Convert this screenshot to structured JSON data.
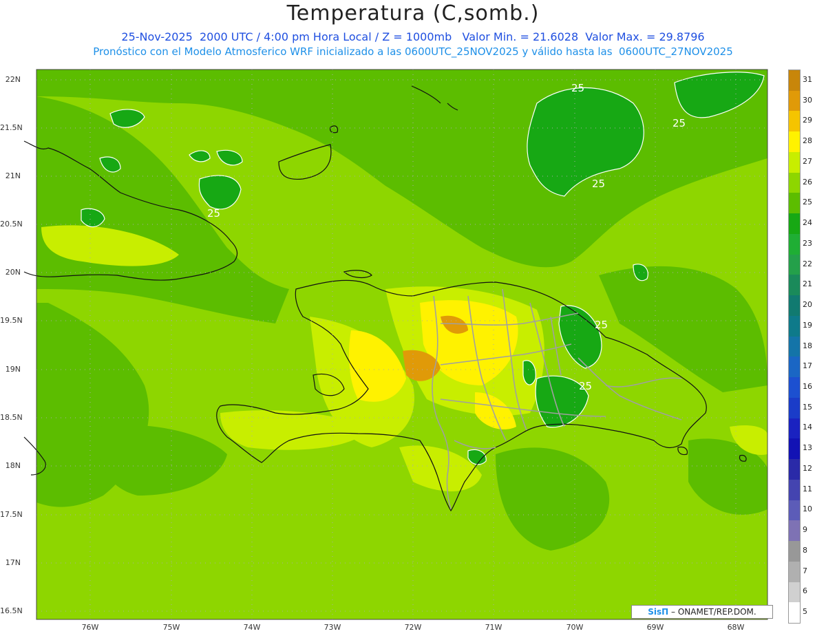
{
  "title": "Temperatura (C,somb.)",
  "subtitle_line1": "25-Nov-2025  2000 UTC / 4:00 pm Hora Local / Z = 1000mb   Valor Min. = 21.6028  Valor Max. = 29.8796",
  "subtitle_line2": "Pronóstico con el Modelo Atmosferico WRF inicializado a las 0600UTC_25NOV2025 y válido hasta las  0600UTC_27NOV2025",
  "lat_ticks": [
    "22N",
    "21.5N",
    "21N",
    "20.5N",
    "20N",
    "19.5N",
    "19N",
    "18.5N",
    "18N",
    "17.5N",
    "17N",
    "16.5N"
  ],
  "lon_ticks": [
    "76W",
    "75W",
    "74W",
    "73W",
    "72W",
    "71W",
    "70W",
    "69W",
    "68W"
  ],
  "contour_labels": [
    "25",
    "25",
    "25",
    "25",
    "25",
    "25",
    "25"
  ],
  "colorbar": {
    "levels": [
      "31",
      "30",
      "29",
      "28",
      "27",
      "26",
      "25",
      "24",
      "23",
      "22",
      "21",
      "20",
      "19",
      "18",
      "17",
      "16",
      "15",
      "14",
      "13",
      "12",
      "11",
      "10",
      "9",
      "8",
      "7",
      "6",
      "5"
    ],
    "colors": [
      "#c8860a",
      "#e09a08",
      "#f5c400",
      "#fff200",
      "#c8ee00",
      "#8ed600",
      "#5cbd00",
      "#17a814",
      "#1fae34",
      "#24a04a",
      "#1a8a5a",
      "#117a70",
      "#0e7a8a",
      "#1474a8",
      "#1a66c4",
      "#1c50d0",
      "#1a3cc8",
      "#1a22c0",
      "#1212b4",
      "#2a2aa8",
      "#4444b0",
      "#5c5cb8",
      "#7e72b4",
      "#989898",
      "#b0b0b0",
      "#d0d0d0",
      "#ffffff"
    ]
  },
  "credit": {
    "logo": "SisΠ",
    "text": " – ONAMET/REP.DOM."
  }
}
